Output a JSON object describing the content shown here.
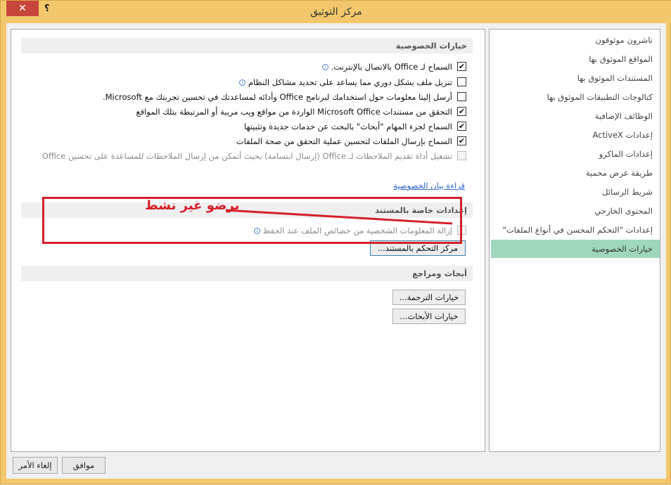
{
  "window": {
    "title": "مركز التوثيق",
    "close_label": "✕",
    "help_label": "؟"
  },
  "nav": {
    "items": [
      "ناشرون موثوقون",
      "المواقع الموثوق بها",
      "المستندات الموثوق بها",
      "كتالوجات التطبيقات الموثوق بها",
      "الوظائف الإضافية",
      "إعدادات ActiveX",
      "إعدادات الماكرو",
      "طريقة عرض محمية",
      "شريط الرسائل",
      "المحتوى الخارجي",
      "إعدادات \"التحكم المحسن في أنواع الملفات\"",
      "خيارات الخصوصية"
    ],
    "selected_index": 11
  },
  "privacy": {
    "header": "خيارات الخصوصية",
    "options": [
      {
        "label": "السماح لـ Office بالاتصال بالإنترنت.",
        "checked": true,
        "disabled": false,
        "info": true
      },
      {
        "label": "تنزيل ملف بشكل دوري مما يساعد على تحديد مشاكل النظام",
        "checked": false,
        "disabled": false,
        "info": true
      },
      {
        "label": "أرسل إلينا معلومات حول استخدامك لبرنامج Office وأدائه لمساعدتك في تحسين تجربتك مع Microsoft.",
        "checked": false,
        "disabled": false,
        "info": false
      },
      {
        "label": "التحقق من مستندات Microsoft Office الواردة من مواقع ويب مريبة أو المرتبطة بتلك المواقع",
        "checked": true,
        "disabled": false,
        "info": false
      },
      {
        "label": "السماح لجزء المهام \"أبحاث\" بالبحث عن خدمات جديدة وتثبيتها",
        "checked": true,
        "disabled": false,
        "info": false
      },
      {
        "label": "السماح بإرسال الملفات لتحسين عملية التحقق من صحة الملفات",
        "checked": true,
        "disabled": false,
        "info": false
      },
      {
        "label": "تشغيل أداة تقديم الملاحظات لـ Office (إرسال ابتسامة) بحيث أتمكن من إرسال الملاحظات للمساعدة على تحسين Office",
        "checked": false,
        "disabled": true,
        "info": false
      }
    ],
    "statement_link": "قراءة بيان الخصوصية"
  },
  "document_settings": {
    "header": "إعدادات خاصة بالمستند",
    "option": {
      "label": "إزالة المعلومات الشخصية من خصائص الملف عند الحفظ",
      "checked": false,
      "disabled": true,
      "info": true
    },
    "inspector_button": "مركز التحكم بالمستند..."
  },
  "research": {
    "header": "أبحاث ومراجع",
    "translation_button": "خيارات الترجمة...",
    "research_button": "خيارات الأبحاث..."
  },
  "annotation": {
    "text": "برضو غير نشط"
  },
  "footer": {
    "ok_label": "موافق",
    "cancel_label": "إلغاء الأمر"
  },
  "colors": {
    "title_bar": "#f3c86c",
    "close_button": "#c7463b",
    "selected_nav": "#9fd7bd",
    "annotation": "#d4202a",
    "link": "#2b63c2"
  }
}
